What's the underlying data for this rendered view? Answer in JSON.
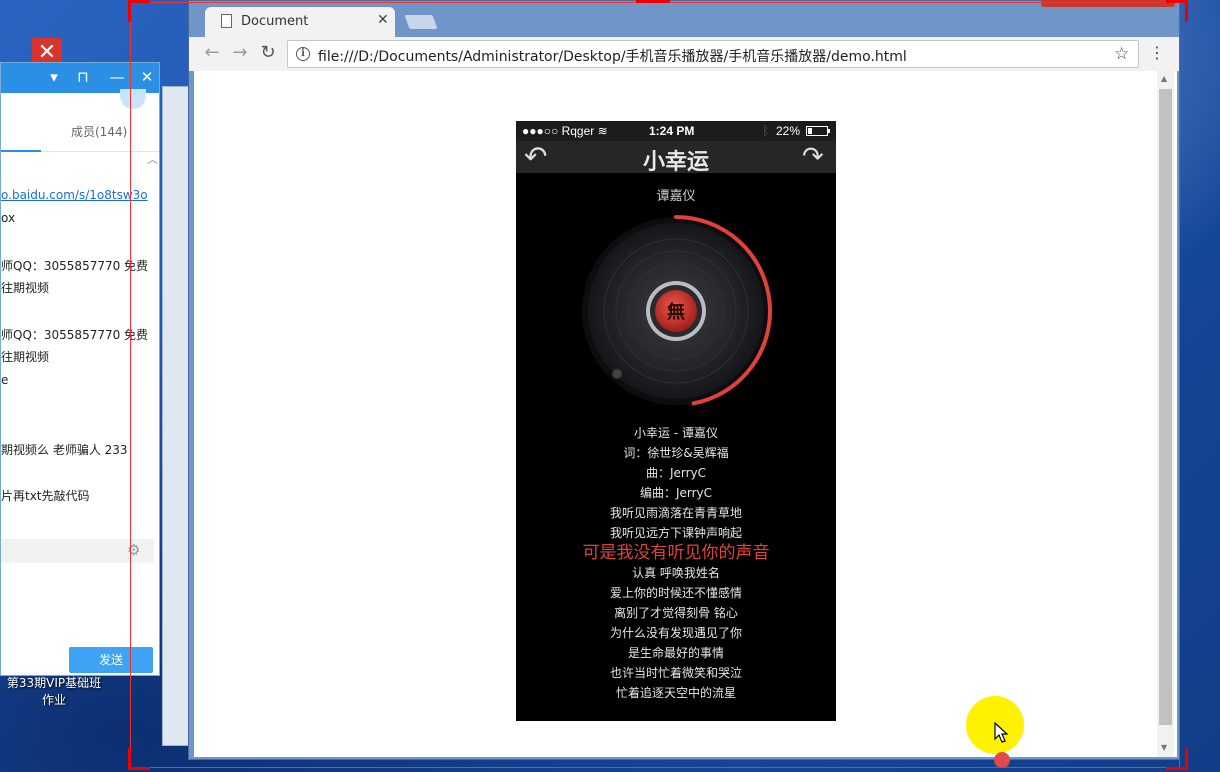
{
  "desktop": {
    "shortcut_label": "第33期VIP基础班作业"
  },
  "chat": {
    "titlebar_buttons": [
      "▾",
      "⊓",
      "—",
      "✕"
    ],
    "members_tab": "成员(144)",
    "messages": [
      "o.baidu.com/s/1o8tsw3o",
      "ox",
      "师QQ：3055857770  免费",
      "往期视频",
      "师QQ：3055857770  免费",
      "往期视频",
      "e",
      "期视频么 老师骗人 233",
      "片再txt先敲代码"
    ],
    "send_label": "发送"
  },
  "browser": {
    "tab_title": "Document",
    "url": "file:///D:/Documents/Administrator/Desktop/手机音乐播放器/手机音乐播放器/demo.html",
    "icons": [
      "back-icon",
      "forward-icon",
      "reload-icon",
      "info-icon",
      "star-icon",
      "menu-icon",
      "close-icon"
    ]
  },
  "phone": {
    "status": {
      "carrier": "●●●○○ Rqger",
      "time": "1:24 PM",
      "battery_text": "22%",
      "battery_level": 0.22
    },
    "song_title": "小幸运",
    "artist": "谭嘉仪",
    "progress_fraction": 0.47,
    "lyrics": [
      "小幸运 - 谭嘉仪",
      "词：徐世珍&吴辉福",
      "曲：JerryC",
      "编曲：JerryC",
      "我听见雨滴落在青青草地",
      "我听见远方下课钟声响起",
      "可是我没有听见你的声音",
      "认真 呼唤我姓名",
      "爱上你的时候还不懂感情",
      "离别了才觉得刻骨 铭心",
      "为什么没有发现遇见了你",
      "是生命最好的事情",
      "也许当时忙着微笑和哭泣",
      "忙着追逐天空中的流星"
    ],
    "active_lyric_index": 6,
    "accent_color": "#e0423a"
  }
}
